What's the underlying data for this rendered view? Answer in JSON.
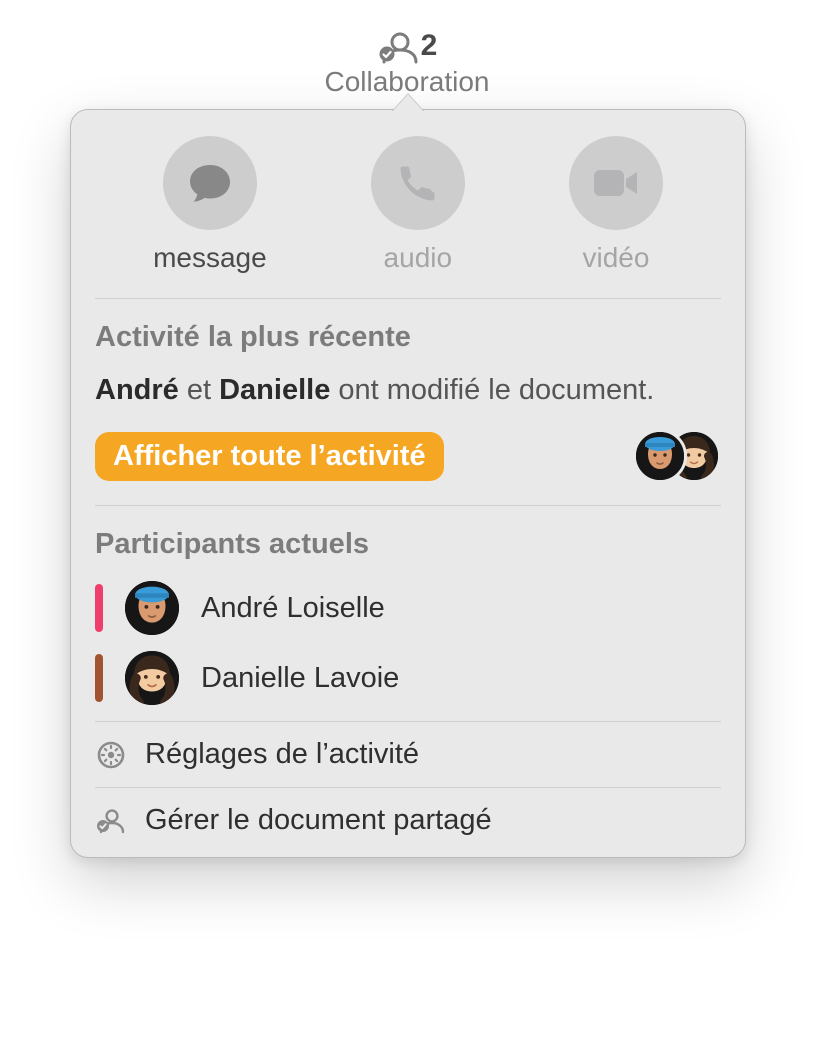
{
  "toolbar": {
    "participant_count": "2",
    "label": "Collaboration"
  },
  "actions": {
    "message": "message",
    "audio": "audio",
    "video": "vidéo"
  },
  "recent": {
    "title": "Activité la plus récente",
    "person1": "André",
    "conjunction": " et ",
    "person2": "Danielle",
    "rest": " ont modifié le document.",
    "show_all_button": "Afficher toute l’activité"
  },
  "participants": {
    "title": "Participants actuels",
    "items": [
      {
        "name": "André Loiselle",
        "color": "#ef3e6b"
      },
      {
        "name": "Danielle Lavoie",
        "color": "#a25332"
      }
    ]
  },
  "menu": {
    "activity_settings": "Réglages de l’activité",
    "manage_shared": "Gérer le document partagé"
  }
}
